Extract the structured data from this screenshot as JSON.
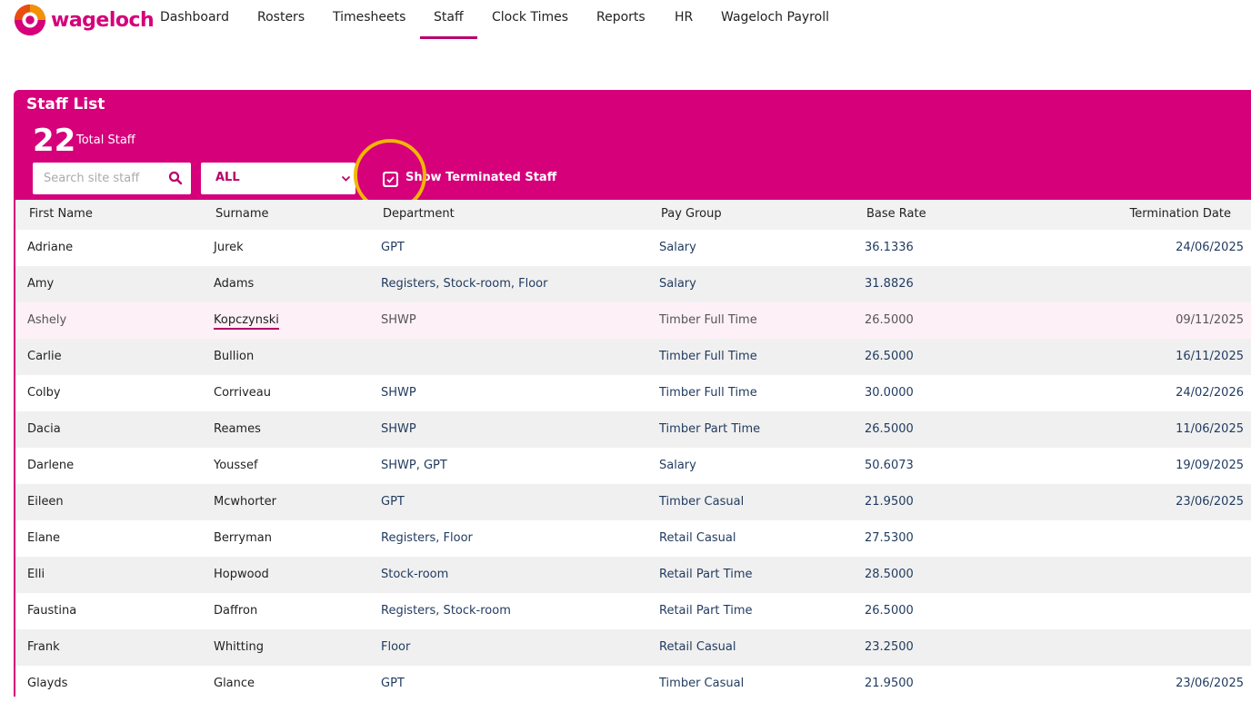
{
  "brand": {
    "name": "wageloch",
    "color": "#d5007a"
  },
  "nav": {
    "items": [
      {
        "label": "Dashboard"
      },
      {
        "label": "Rosters"
      },
      {
        "label": "Timesheets"
      },
      {
        "label": "Staff",
        "active": true
      },
      {
        "label": "Clock Times"
      },
      {
        "label": "Reports"
      },
      {
        "label": "HR"
      },
      {
        "label": "Wageloch Payroll"
      }
    ]
  },
  "staff_panel": {
    "title": "Staff List",
    "total_count": "22",
    "total_label": "Total Staff",
    "search_placeholder": "Search site staff",
    "department_filter": "ALL",
    "show_terminated_label": "Show Terminated Staff",
    "show_terminated_checked": true
  },
  "table": {
    "headers": {
      "first_name": "First Name",
      "surname": "Surname",
      "department": "Department",
      "pay_group": "Pay Group",
      "base_rate": "Base Rate",
      "termination_date": "Termination Date"
    },
    "rows": [
      {
        "first": "Adriane",
        "surname": "Jurek",
        "dept": "GPT",
        "pay": "Salary",
        "rate": "36.1336",
        "term": "24/06/2025"
      },
      {
        "first": "Amy",
        "surname": "Adams",
        "dept": "Registers, Stock-room, Floor",
        "pay": "Salary",
        "rate": "31.8826",
        "term": ""
      },
      {
        "first": "Ashely",
        "surname": "Kopczynski",
        "dept": "SHWP",
        "pay": "Timber Full Time",
        "rate": "26.5000",
        "term": "09/11/2025"
      },
      {
        "first": "Carlie",
        "surname": "Bullion",
        "dept": "",
        "pay": "Timber Full Time",
        "rate": "26.5000",
        "term": "16/11/2025"
      },
      {
        "first": "Colby",
        "surname": "Corriveau",
        "dept": "SHWP",
        "pay": "Timber Full Time",
        "rate": "30.0000",
        "term": "24/02/2026"
      },
      {
        "first": "Dacia",
        "surname": "Reames",
        "dept": "SHWP",
        "pay": "Timber Part Time",
        "rate": "26.5000",
        "term": "11/06/2025"
      },
      {
        "first": "Darlene",
        "surname": "Youssef",
        "dept": "SHWP, GPT",
        "pay": "Salary",
        "rate": "50.6073",
        "term": "19/09/2025"
      },
      {
        "first": "Eileen",
        "surname": "Mcwhorter",
        "dept": "GPT",
        "pay": "Timber Casual",
        "rate": "21.9500",
        "term": "23/06/2025"
      },
      {
        "first": "Elane",
        "surname": "Berryman",
        "dept": "Registers, Floor",
        "pay": "Retail Casual",
        "rate": "27.5300",
        "term": ""
      },
      {
        "first": "Elli",
        "surname": "Hopwood",
        "dept": "Stock-room",
        "pay": "Retail Part Time",
        "rate": "28.5000",
        "term": ""
      },
      {
        "first": "Faustina",
        "surname": "Daffron",
        "dept": "Registers, Stock-room",
        "pay": "Retail Part Time",
        "rate": "26.5000",
        "term": ""
      },
      {
        "first": "Frank",
        "surname": "Whitting",
        "dept": "Floor",
        "pay": "Retail Casual",
        "rate": "23.2500",
        "term": ""
      },
      {
        "first": "Glayds",
        "surname": "Glance",
        "dept": "GPT",
        "pay": "Timber Casual",
        "rate": "21.9500",
        "term": "23/06/2025"
      }
    ]
  }
}
